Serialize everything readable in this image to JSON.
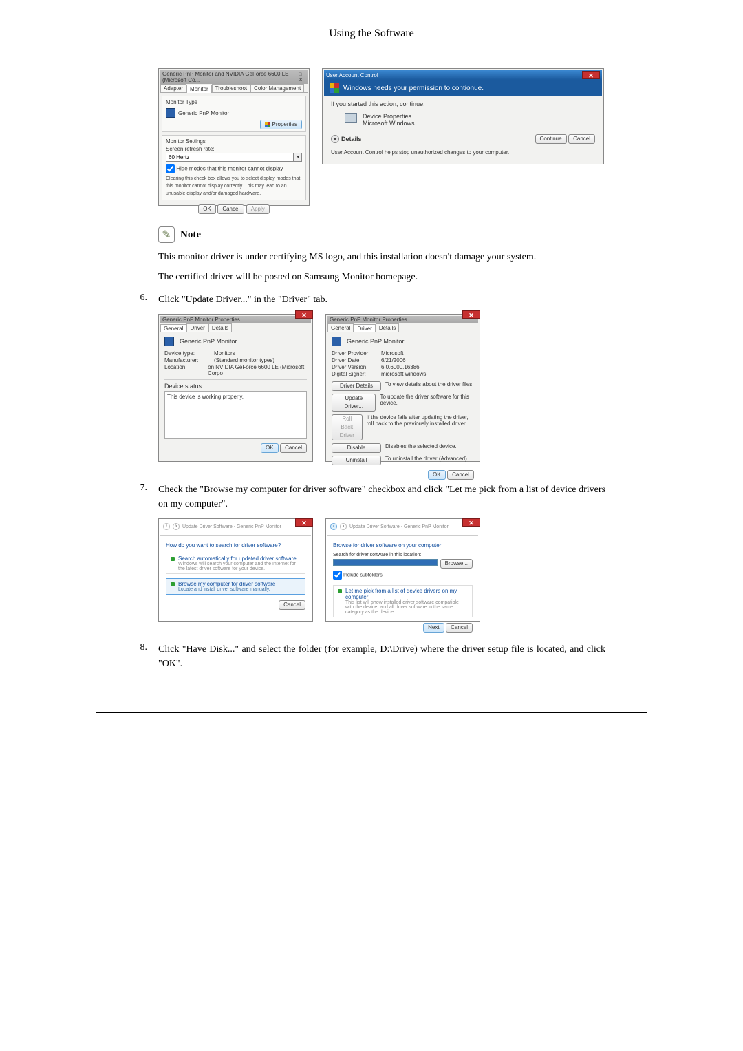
{
  "header": {
    "title": "Using the Software"
  },
  "fig1": {
    "shotA": {
      "title": "Generic PnP Monitor and NVIDIA GeForce 6600 LE (Microsoft Co...",
      "tabs": {
        "adapter": "Adapter",
        "monitor": "Monitor",
        "troubleshoot": "Troubleshoot",
        "color": "Color Management"
      },
      "monitor_type_label": "Monitor Type",
      "monitor_name": "Generic PnP Monitor",
      "properties_btn": "Properties",
      "settings_label": "Monitor Settings",
      "refresh_label": "Screen refresh rate:",
      "refresh_value": "60 Hertz",
      "hide_checkbox": "Hide modes that this monitor cannot display",
      "hide_desc": "Clearing this check box allows you to select display modes that this monitor cannot display correctly. This may lead to an unusable display and/or damaged hardware.",
      "ok": "OK",
      "cancel": "Cancel",
      "apply": "Apply"
    },
    "shotB": {
      "title": "User Account Control",
      "headline": "Windows needs your permission to contionue.",
      "action_label": "If you started this action, continue.",
      "program_name": "Device Properties",
      "publisher": "Microsoft Windows",
      "details": "Details",
      "continue_btn": "Continue",
      "cancel_btn": "Cancel",
      "footer": "User Account Control helps stop unauthorized changes to your computer."
    }
  },
  "note": {
    "label": "Note",
    "line1": "This monitor driver is under certifying MS logo, and this installation doesn't damage your system.",
    "line2": "The certified driver will be posted on Samsung Monitor homepage."
  },
  "steps": {
    "s6": {
      "num": "6.",
      "text": "Click \"Update Driver...\" in the \"Driver\" tab."
    },
    "s7": {
      "num": "7.",
      "text": "Check the \"Browse my computer for driver software\" checkbox and click \"Let me pick from a list of device drivers on my computer\"."
    },
    "s8": {
      "num": "8.",
      "text": "Click \"Have Disk...\" and select the folder (for example, D:\\Drive) where the driver setup file is located, and click \"OK\"."
    }
  },
  "fig2": {
    "title": "Generic PnP Monitor Properties",
    "tabs": {
      "general": "General",
      "driver": "Driver",
      "details": "Details"
    },
    "device_name": "Generic PnP Monitor",
    "left": {
      "device_type_k": "Device type:",
      "device_type_v": "Monitors",
      "manufacturer_k": "Manufacturer:",
      "manufacturer_v": "(Standard monitor types)",
      "location_k": "Location:",
      "location_v": "on NVIDIA GeForce 6600 LE (Microsoft Corpo",
      "status_k": "Device status",
      "status_v": "This device is working properly.",
      "ok": "OK",
      "cancel": "Cancel"
    },
    "right": {
      "provider_k": "Driver Provider:",
      "provider_v": "Microsoft",
      "date_k": "Driver Date:",
      "date_v": "6/21/2006",
      "version_k": "Driver Version:",
      "version_v": "6.0.6000.16386",
      "signer_k": "Digital Signer:",
      "signer_v": "microsoft windows",
      "btn_details": "Driver Details",
      "btn_details_desc": "To view details about the driver files.",
      "btn_update": "Update Driver...",
      "btn_update_desc": "To update the driver software for this device.",
      "btn_rollback": "Roll Back Driver",
      "btn_rollback_desc": "If the device fails after updating the driver, roll back to the previously installed driver.",
      "btn_disable": "Disable",
      "btn_disable_desc": "Disables the selected device.",
      "btn_uninstall": "Uninstall",
      "btn_uninstall_desc": "To uninstall the driver (Advanced).",
      "ok": "OK",
      "cancel": "Cancel"
    }
  },
  "fig3": {
    "left": {
      "crumb": "Update Driver Software - Generic PnP Monitor",
      "heading": "How do you want to search for driver software?",
      "opt1_title": "Search automatically for updated driver software",
      "opt1_desc": "Windows will search your computer and the Internet for the latest driver software for your device.",
      "opt2_title": "Browse my computer for driver software",
      "opt2_desc": "Locate and install driver software manually.",
      "cancel": "Cancel"
    },
    "right": {
      "crumb": "Update Driver Software - Generic PnP Monitor",
      "heading": "Browse for driver software on your computer",
      "search_label": "Search for driver software in this location:",
      "browse_btn": "Browse...",
      "include_sub": "Include subfolders",
      "pick_title": "Let me pick from a list of device drivers on my computer",
      "pick_desc": "This list will show installed driver software compatible with the device, and all driver software in the same category as the device.",
      "next": "Next",
      "cancel": "Cancel"
    }
  }
}
